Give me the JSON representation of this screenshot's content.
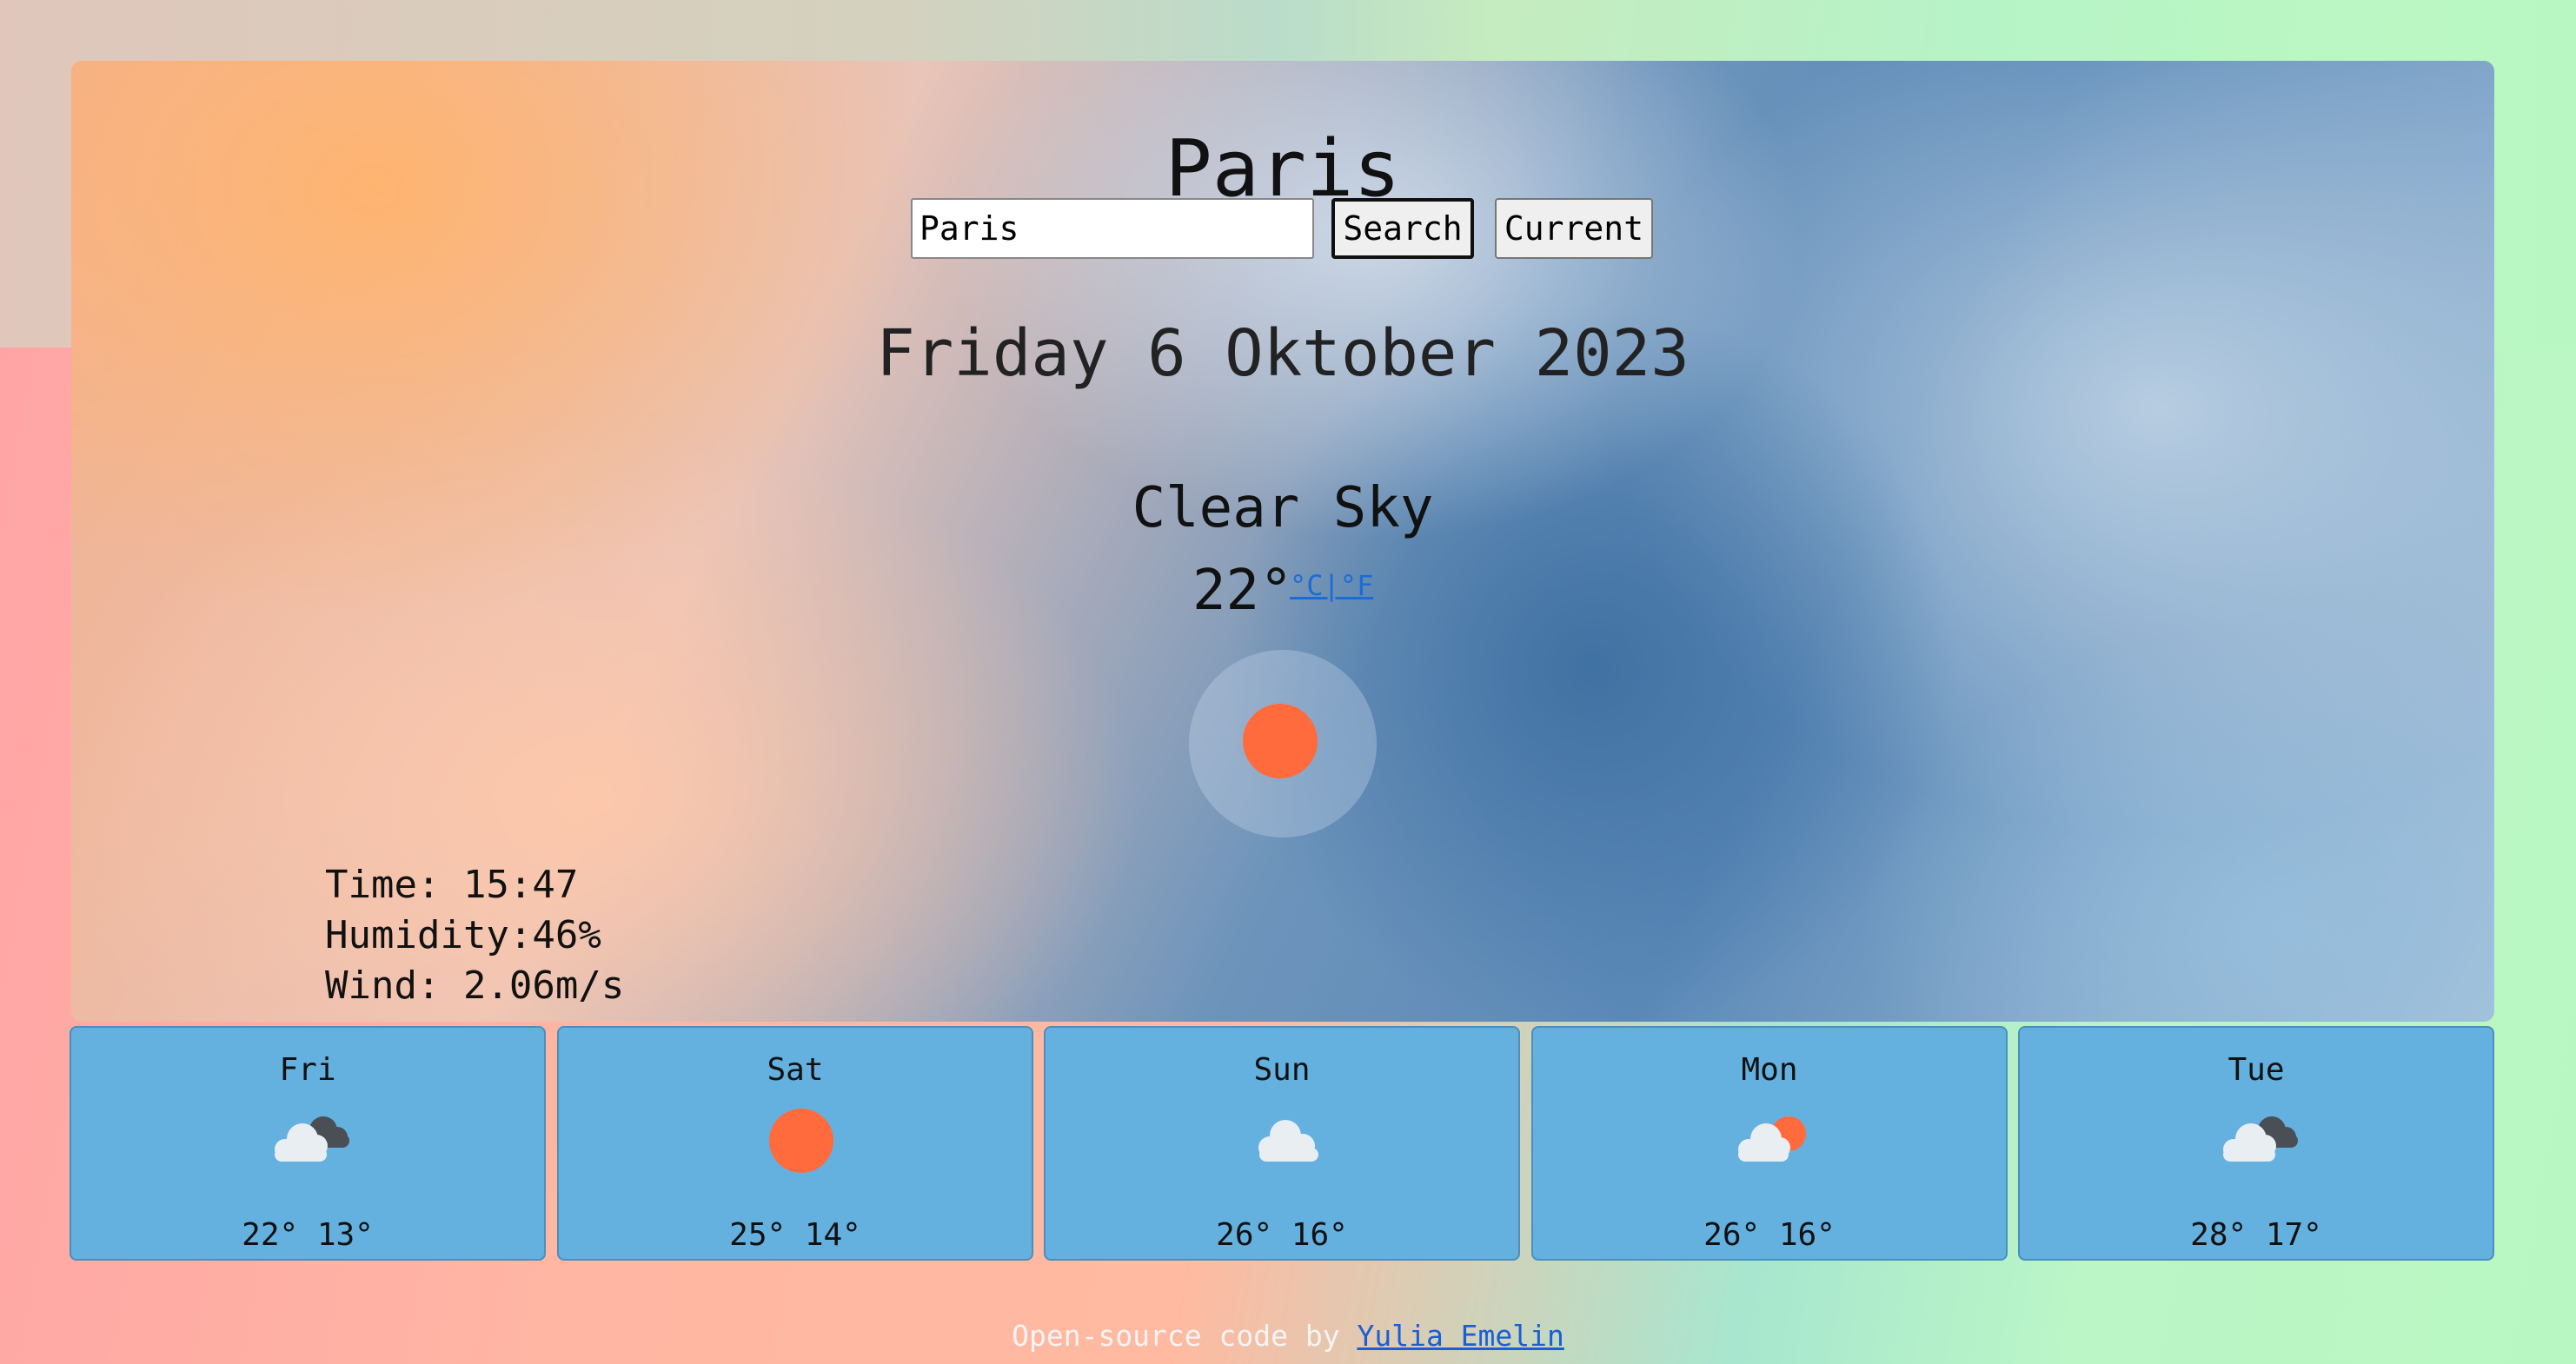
{
  "header": {
    "city": "Paris"
  },
  "search": {
    "value": "Paris",
    "search_label": "Search",
    "current_label": "Current"
  },
  "date": "Friday 6 Oktober 2023",
  "current": {
    "description": "Clear Sky",
    "temperature": "22°",
    "unit_c": "°C",
    "unit_sep": "|",
    "unit_f": "°F",
    "icon": "clear-sun-icon",
    "time": "Time: 15:47",
    "humidity": "Humidity:46%",
    "wind": "Wind: 2.06m/s"
  },
  "forecast": [
    {
      "day": "Fri",
      "temps": "22° 13°",
      "icon": "broken-clouds-icon"
    },
    {
      "day": "Sat",
      "temps": "25° 14°",
      "icon": "clear-sun-icon"
    },
    {
      "day": "Sun",
      "temps": "26° 16°",
      "icon": "cloud-icon"
    },
    {
      "day": "Mon",
      "temps": "26° 16°",
      "icon": "few-clouds-sun-icon"
    },
    {
      "day": "Tue",
      "temps": "28° 17°",
      "icon": "broken-clouds-icon"
    }
  ],
  "footer": {
    "text": "Open-source code by ",
    "author": "Yulia Emelin"
  },
  "colors": {
    "sun": "#ff6b3d",
    "card": "#64b0df",
    "link": "#1a5fd6"
  }
}
